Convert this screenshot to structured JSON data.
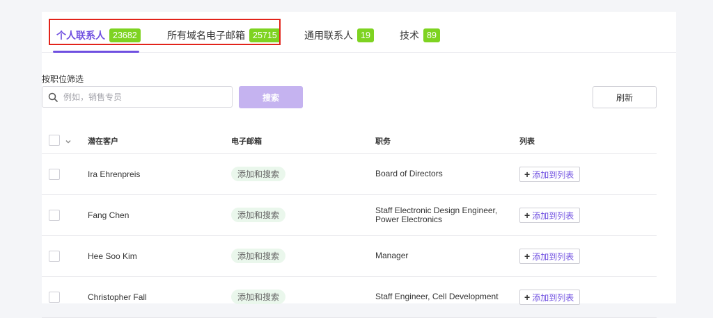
{
  "tabs": [
    {
      "label": "个人联系人",
      "count": "23682"
    },
    {
      "label": "所有域名电子邮箱",
      "count": "25715"
    },
    {
      "label": "通用联系人",
      "count": "19"
    },
    {
      "label": "技术",
      "count": "89"
    }
  ],
  "filter": {
    "label": "按职位筛选",
    "placeholder": "例如，销售专员",
    "search_button": "搜索",
    "refresh_button": "刷新"
  },
  "table": {
    "headers": {
      "lead": "潜在客户",
      "email": "电子邮箱",
      "title": "职务",
      "list": "列表"
    },
    "rows": [
      {
        "name": "Ira Ehrenpreis",
        "email": "添加和搜索",
        "title": "Board of Directors",
        "list": "添加到列表"
      },
      {
        "name": "Fang Chen",
        "email": "添加和搜索",
        "title": "Staff Electronic Design Engineer, Power Electronics",
        "list": "添加到列表"
      },
      {
        "name": "Hee Soo Kim",
        "email": "添加和搜索",
        "title": "Manager",
        "list": "添加到列表"
      },
      {
        "name": "Christopher Fall",
        "email": "添加和搜索",
        "title": "Staff Engineer, Cell Development",
        "list": "添加到列表"
      }
    ]
  },
  "colors": {
    "accent": "#6f4fe0",
    "badge": "#7ed321",
    "highlight": "#e2231a"
  }
}
